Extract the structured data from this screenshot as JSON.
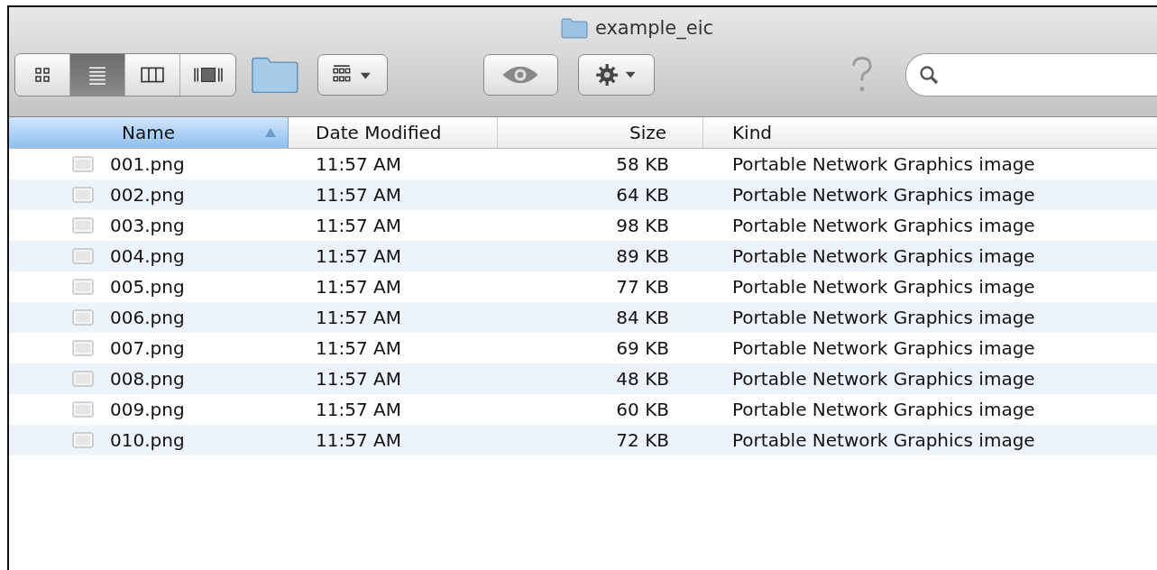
{
  "window": {
    "title": "example_eic"
  },
  "view_modes": [
    {
      "kind": "icons",
      "selected": false
    },
    {
      "kind": "list",
      "selected": true
    },
    {
      "kind": "columns",
      "selected": false
    },
    {
      "kind": "coverflow",
      "selected": false
    }
  ],
  "table": {
    "columns": [
      {
        "label": "Name",
        "sorted": true
      },
      {
        "label": "Date Modified",
        "sorted": false
      },
      {
        "label": "Size",
        "sorted": false
      },
      {
        "label": "Kind",
        "sorted": false
      }
    ],
    "rows": [
      {
        "name": "001.png",
        "date": "11:57 AM",
        "size": "58 KB",
        "kind": "Portable Network Graphics image"
      },
      {
        "name": "002.png",
        "date": "11:57 AM",
        "size": "64 KB",
        "kind": "Portable Network Graphics image"
      },
      {
        "name": "003.png",
        "date": "11:57 AM",
        "size": "98 KB",
        "kind": "Portable Network Graphics image"
      },
      {
        "name": "004.png",
        "date": "11:57 AM",
        "size": "89 KB",
        "kind": "Portable Network Graphics image"
      },
      {
        "name": "005.png",
        "date": "11:57 AM",
        "size": "77 KB",
        "kind": "Portable Network Graphics image"
      },
      {
        "name": "006.png",
        "date": "11:57 AM",
        "size": "84 KB",
        "kind": "Portable Network Graphics image"
      },
      {
        "name": "007.png",
        "date": "11:57 AM",
        "size": "69 KB",
        "kind": "Portable Network Graphics image"
      },
      {
        "name": "008.png",
        "date": "11:57 AM",
        "size": "48 KB",
        "kind": "Portable Network Graphics image"
      },
      {
        "name": "009.png",
        "date": "11:57 AM",
        "size": "60 KB",
        "kind": "Portable Network Graphics image"
      },
      {
        "name": "010.png",
        "date": "11:57 AM",
        "size": "72 KB",
        "kind": "Portable Network Graphics image"
      }
    ]
  }
}
